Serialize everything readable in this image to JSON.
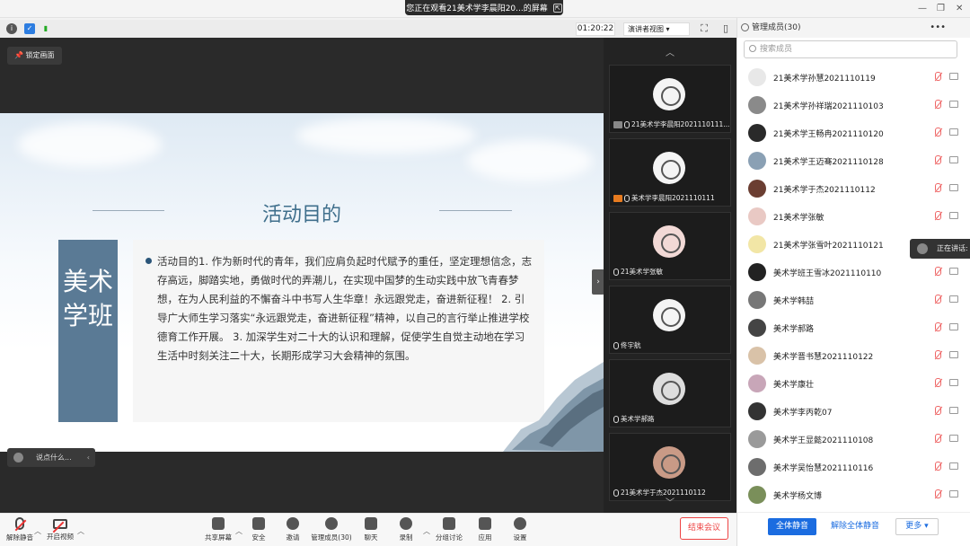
{
  "banner": {
    "text": "您正在观看21美术学李晨阳20...的屏幕"
  },
  "meeting_bar": {
    "timer": "01:20:22",
    "view_mode": "演讲者视图"
  },
  "stage": {
    "lock_label": "锁定画面",
    "chat_placeholder": "说点什么..."
  },
  "slide": {
    "title": "活动目的",
    "side_label": "美术学班",
    "body": "活动目的1. 作为新时代的青年，我们应肩负起时代赋予的重任，坚定理想信念，志存高远，脚踏实地，勇做时代的弄潮儿，在实现中国梦的生动实践中放飞青春梦想，在为人民利益的不懈奋斗中书写人生华章！永远跟党走，奋进新征程！ 2. 引导广大师生学习落实“永远跟党走，奋进新征程”精神，以自己的言行举止推进学校德育工作开展。 3. 加深学生对二十大的认识和理解，促使学生自觉主动地在学习生活中时刻关注二十大，长期形成学习大会精神的氛围。"
  },
  "strip": {
    "tiles": [
      {
        "name": "21美术学李晨阳2021110111..."
      },
      {
        "name": "美术学李晨阳2021110111"
      },
      {
        "name": "21美术学张敏"
      },
      {
        "name": "佟宇航"
      },
      {
        "name": "美术学郝路"
      },
      {
        "name": "21美术学于杰2021110112"
      }
    ]
  },
  "panel": {
    "title": "管理成员(30)",
    "search_placeholder": "搜索成员",
    "talking_label": "正在讲话:",
    "members": [
      "21美术学孙慧2021110119",
      "21美术学孙祥瑞2021110103",
      "21美术学王畅冉2021110120",
      "21美术学王迈骞2021110128",
      "21美术学于杰2021110112",
      "21美术学张敏",
      "21美术学张雪叶2021110121",
      "美术学班王雪冰2021110110",
      "美术学韩喆",
      "美术学郝路",
      "美术学晋书慧2021110122",
      "美术学康壮",
      "美术学李丙乾07",
      "美术学王显懿2021110108",
      "美术学吴怡慧2021110116",
      "美术学杨文博"
    ],
    "mute_all": "全体静音",
    "unmute_all": "解除全体静音",
    "more": "更多"
  },
  "toolbar": {
    "unmute": "解除静音",
    "start_video": "开启视频",
    "share_screen": "共享屏幕",
    "security": "安全",
    "invite": "邀请",
    "manage_members": "管理成员(30)",
    "chat": "聊天",
    "record": "录制",
    "breakout": "分组讨论",
    "apps": "应用",
    "settings": "设置",
    "end_meeting": "结束会议"
  }
}
